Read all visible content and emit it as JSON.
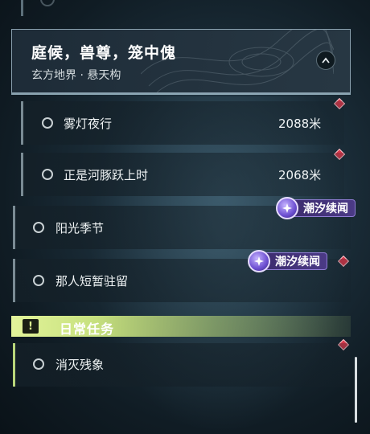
{
  "region": {
    "title": "庭候，兽尊，笼中傀",
    "subtitle": "玄方地界 · 悬天构"
  },
  "quests": [
    {
      "label": "雾灯夜行",
      "distance": "2088米"
    },
    {
      "label": "正是河豚跃上时",
      "distance": "2068米"
    },
    {
      "label": "阳光季节",
      "tag": "潮汐续闻"
    },
    {
      "label": "那人短暂驻留",
      "tag": "潮汐续闻"
    }
  ],
  "daily": {
    "title": "日常任务",
    "alert_glyph": "!",
    "quests": [
      {
        "label": "消灭残象"
      }
    ]
  },
  "colors": {
    "tracked_marker": "#d8384b",
    "tag_bg": "#4b3a86",
    "daily_accent": "#e3f49a"
  },
  "icons": {
    "collapse": "chevron-up-icon",
    "tag": "tidal-star-icon",
    "marker": "diamond-marker-icon",
    "status": "circle-status-icon",
    "daily": "exclamation-icon"
  }
}
